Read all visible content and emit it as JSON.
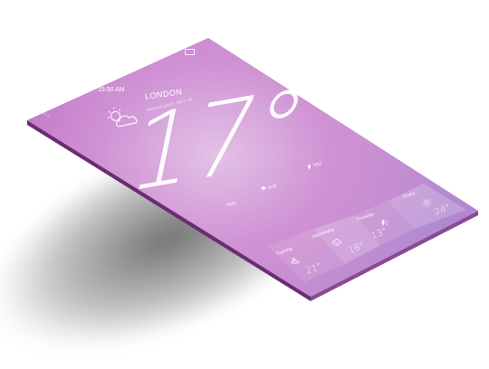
{
  "status_bar": {
    "carrier_signal": "●●○○○",
    "time": "15:50 AM",
    "battery_text": "23%"
  },
  "location": {
    "city": "LONDON",
    "date": "WEDNESDAY, MAY 16"
  },
  "current": {
    "temperature": "17°",
    "condition_icon": "partly-cloudy-icon",
    "wind": "4kph",
    "rain": "%35",
    "humidity": "%52"
  },
  "forecast": [
    {
      "day": "Tuesday",
      "temp": "21°",
      "icon": "sun-cloud-icon"
    },
    {
      "day": "Wednesday",
      "temp": "18°",
      "icon": "cloud-rain-icon"
    },
    {
      "day": "Thursday",
      "temp": "13°",
      "icon": "storm-icon"
    },
    {
      "day": "Friday",
      "temp": "24°",
      "icon": "sun-icon"
    }
  ],
  "colors": {
    "screen_gradient_start": "#b85cbd",
    "screen_gradient_end": "#a47fcf",
    "text": "#ffffff"
  }
}
